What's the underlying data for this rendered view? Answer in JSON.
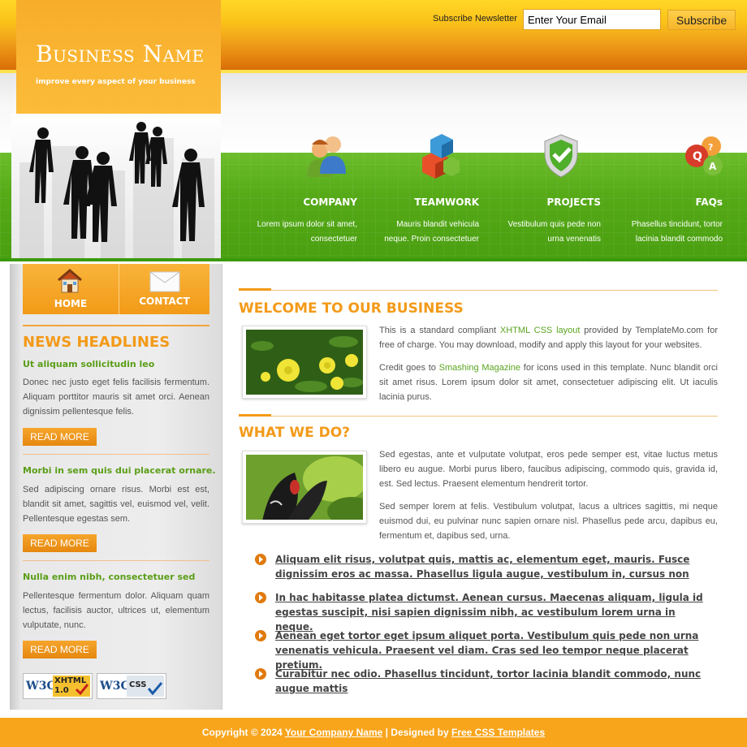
{
  "header": {
    "business_name": "Business Name",
    "tagline": "improve every aspect of your business",
    "subscribe_label": "Subscribe Newsletter",
    "email_value": "Enter Your Email",
    "subscribe_button": "Subscribe"
  },
  "features": [
    {
      "title": "COMPANY",
      "desc1": "Lorem ipsum dolor sit amet,",
      "desc2": "consectetuer",
      "icon": "people-icon"
    },
    {
      "title": "TEAMWORK",
      "desc1": "Mauris blandit vehicula",
      "desc2": "neque. Proin consectetuer",
      "icon": "blocks-icon"
    },
    {
      "title": "PROJECTS",
      "desc1": "Vestibulum quis pede non",
      "desc2": "urna venenatis",
      "icon": "shield-check-icon"
    },
    {
      "title": "FAQs",
      "desc1": "Phasellus tincidunt, tortor",
      "desc2": "lacinia blandit commodo",
      "icon": "qa-bubbles-icon"
    }
  ],
  "nav": {
    "home": "HOME",
    "contact": "CONTACT"
  },
  "news": {
    "heading": "NEWS HEADLINES",
    "items": [
      {
        "title": "Ut aliquam sollicitudin leo",
        "text": "Donec nec justo eget felis facilisis fermentum. Aliquam porttitor mauris sit amet orci. Aenean dignissim pellentesque felis.",
        "button": "READ MORE"
      },
      {
        "title": "Morbi in sem quis dui placerat ornare.",
        "text": "Sed adipiscing ornare risus. Morbi est est, blandit sit amet, sagittis vel, euismod vel, velit. Pellentesque egestas sem.",
        "button": "READ MORE"
      },
      {
        "title": "Nulla enim nibh, consectetuer sed",
        "text": "Pellentesque fermentum dolor. Aliquam quam lectus, facilisis auctor, ultrices ut, elementum vulputate, nunc.",
        "button": "READ MORE"
      }
    ]
  },
  "badges": {
    "xhtml": "XHTML",
    "xhtml_ver": "1.0",
    "css": "CSS",
    "w3c": "W3C"
  },
  "welcome": {
    "heading": "WELCOME TO OUR BUSINESS",
    "p1_a": "This is a standard compliant ",
    "p1_link": "XHTML CSS layout",
    "p1_b": " provided by TemplateMo.com for free of charge. You may download, modify and apply this layout for your websites.",
    "p2_a": "Credit goes to ",
    "p2_link": "Smashing Magazine",
    "p2_b": " for icons used in this template. Nunc blandit orci sit amet risus. Lorem ipsum dolor sit amet, consectetuer adipiscing elit. Ut iaculis lacinia purus."
  },
  "whatwedo": {
    "heading": "WHAT WE DO?",
    "p1": "Sed egestas, ante et vulputate volutpat, eros pede semper est, vitae luctus metus libero eu augue. Morbi purus libero, faucibus adipiscing, commodo quis, gravida id, est. Sed lectus. Praesent elementum hendrerit tortor.",
    "p2": "Sed semper lorem at felis. Vestibulum volutpat, lacus a ultrices sagittis, mi neque euismod dui, eu pulvinar nunc sapien ornare nisl. Phasellus pede arcu, dapibus eu, fermentum et, dapibus sed, urna."
  },
  "links": [
    "Aliquam elit risus, volutpat quis, mattis ac, elementum eget, mauris. Fusce dignissim eros ac massa. Phasellus ligula augue, vestibulum in, cursus non",
    "In hac habitasse platea dictumst. Aenean cursus. Maecenas aliquam, ligula id egestas suscipit, nisi sapien dignissim nibh, ac vestibulum lorem urna in neque.",
    "Aenean eget tortor eget ipsum aliquet porta. Vestibulum quis pede non urna venenatis vehicula. Praesent vel diam. Cras sed leo tempor neque placerat pretium.",
    "Curabitur nec odio. Phasellus tincidunt, tortor lacinia blandit commodo, nunc augue mattis"
  ],
  "footer": {
    "copyright": "Copyright © 2024 ",
    "company_link": "Your Company Name",
    "designed_by": " | Designed by ",
    "designer_link": "Free CSS Templates"
  },
  "colors": {
    "orange": "#f39a18",
    "green": "#58ab1a",
    "link_green": "#5aa520"
  }
}
